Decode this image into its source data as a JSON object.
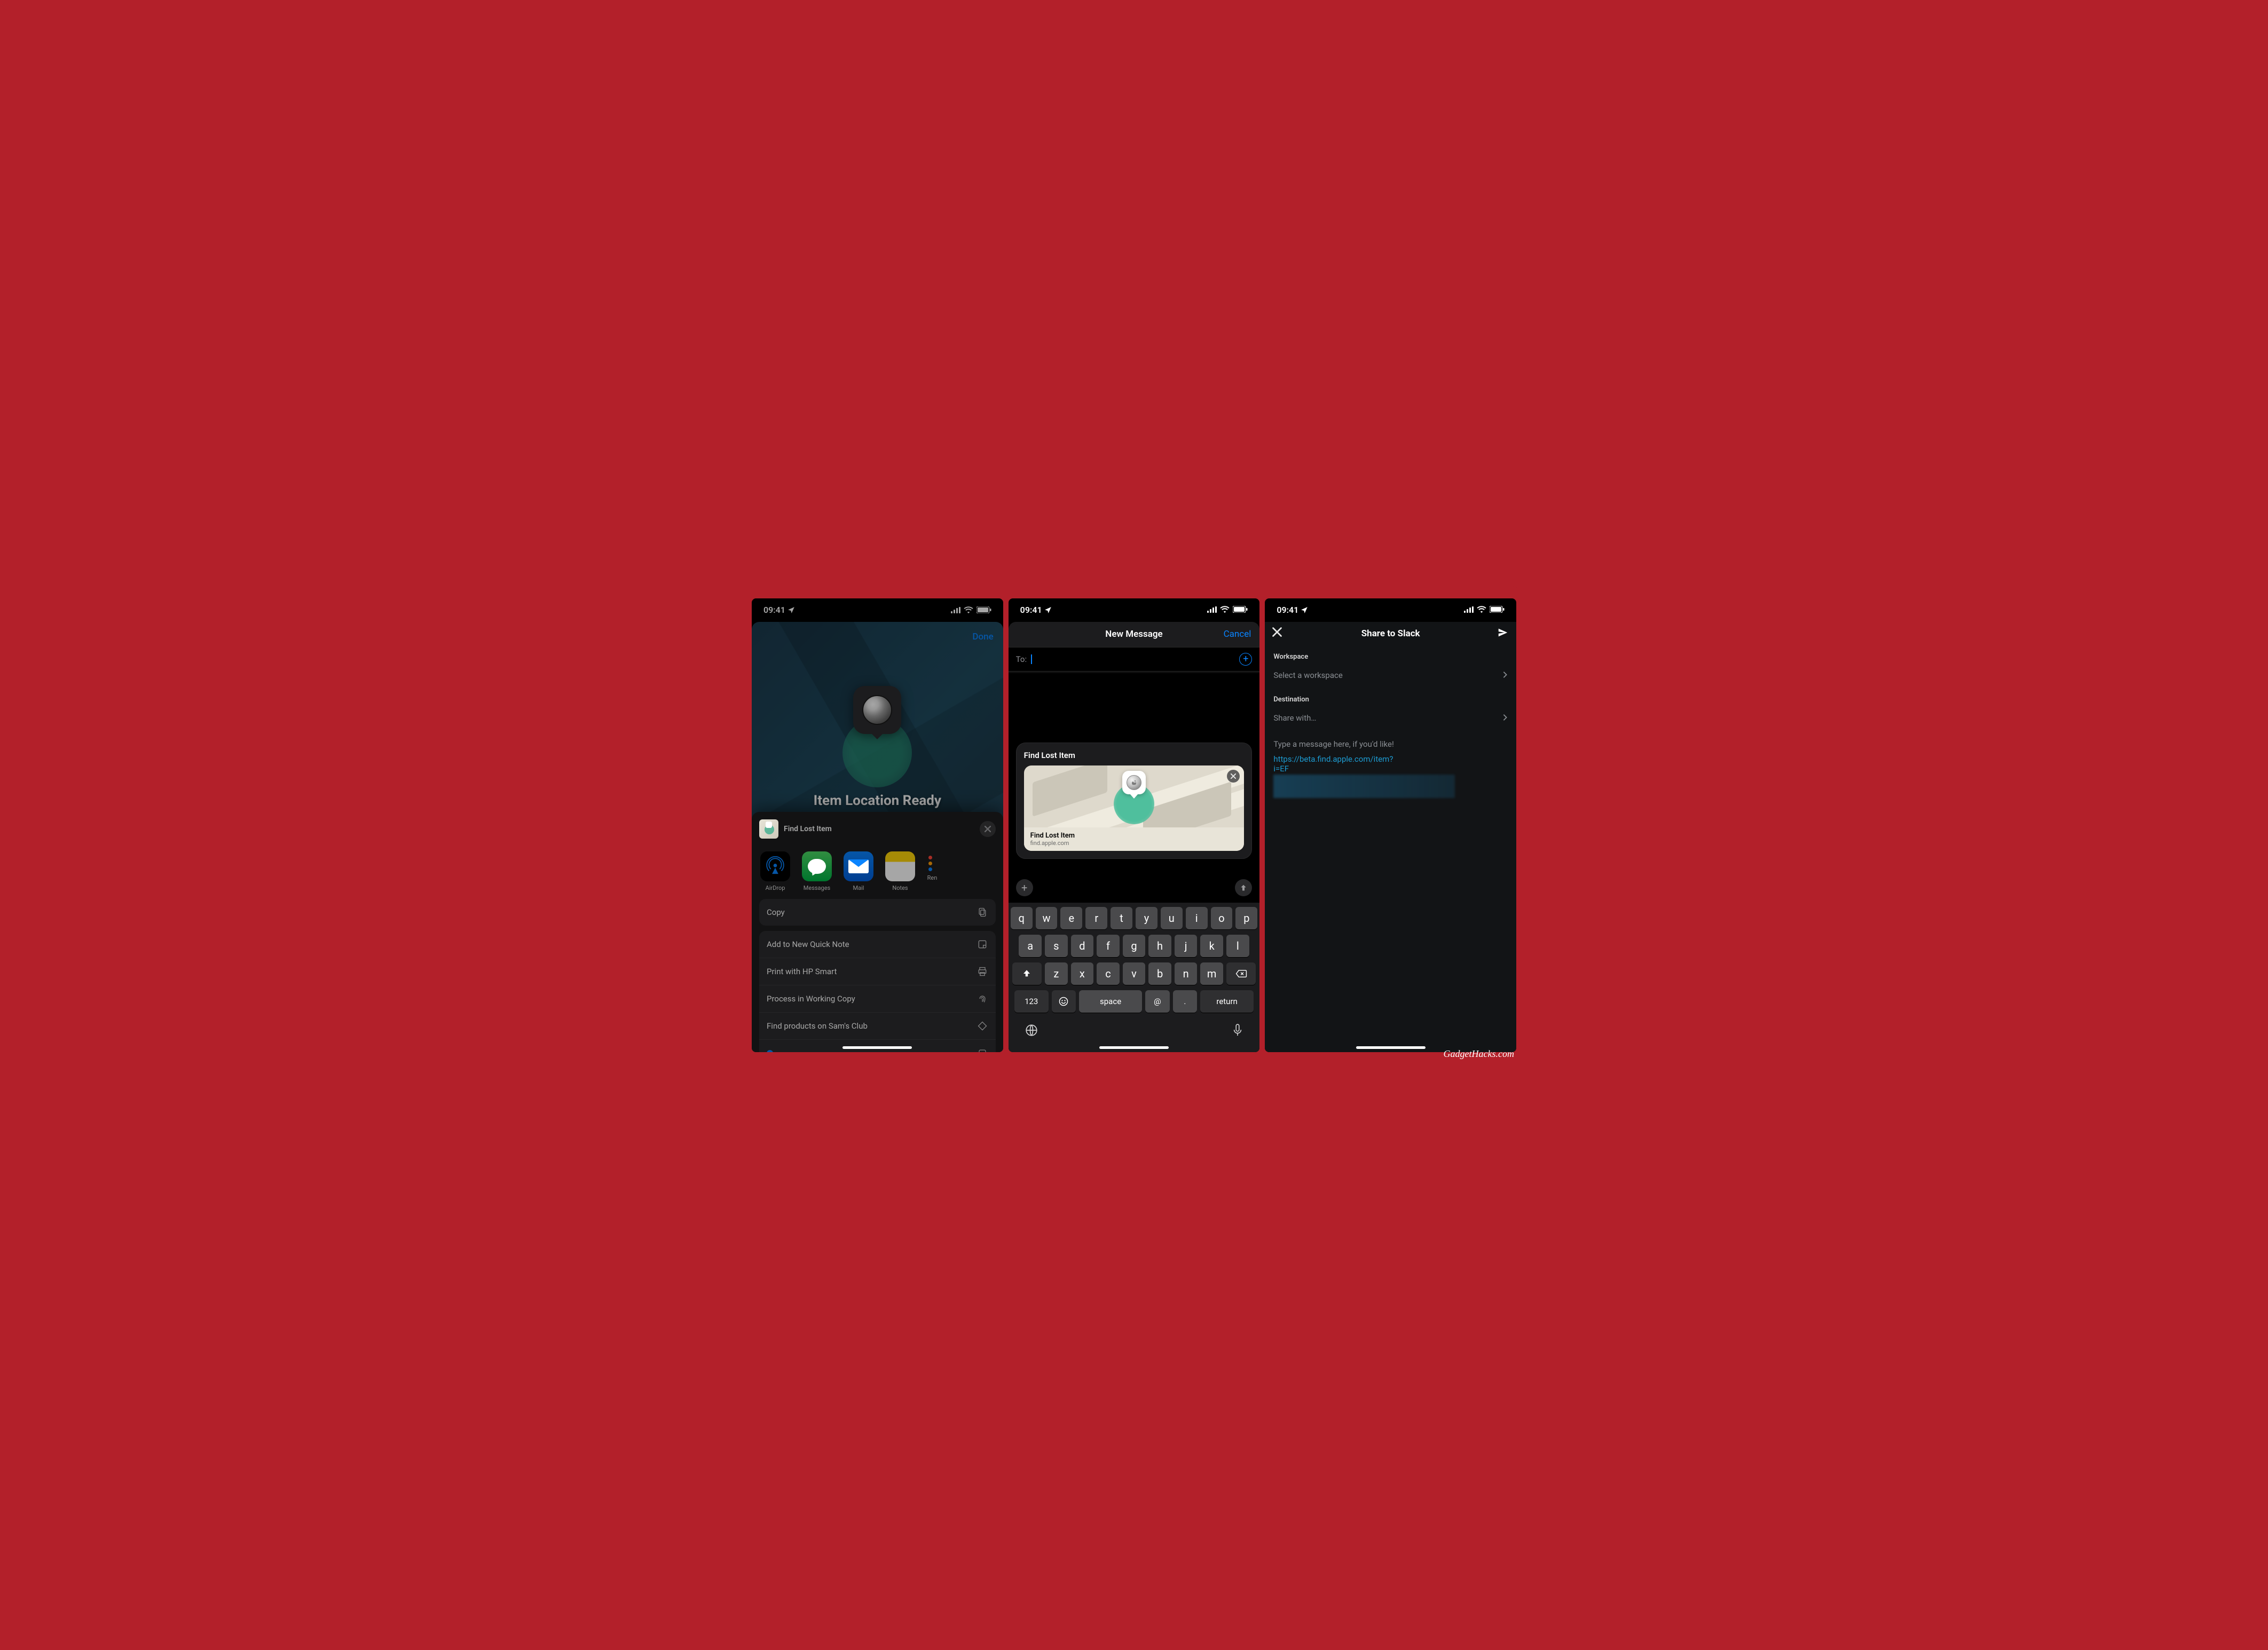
{
  "statusbar": {
    "time": "09:41"
  },
  "watermark": "GadgetHacks.com",
  "phone1": {
    "done": "Done",
    "heading": "Item Location Ready",
    "share": {
      "title": "Find Lost Item",
      "apps": [
        {
          "label": "AirDrop",
          "icon": "airdrop"
        },
        {
          "label": "Messages",
          "icon": "messages"
        },
        {
          "label": "Mail",
          "icon": "mail"
        },
        {
          "label": "Notes",
          "icon": "notes"
        },
        {
          "label": "Ren",
          "icon": "reminders"
        }
      ],
      "copy": "Copy",
      "actions": [
        "Add to New Quick Note",
        "Print with HP Smart",
        "Process in Working Copy",
        "Find products on Sam's Club"
      ]
    }
  },
  "phone2": {
    "nav_title": "New Message",
    "cancel": "Cancel",
    "to_label": "To:",
    "card_title": "Find Lost Item",
    "preview_title": "Find Lost Item",
    "preview_domain": "find.apple.com",
    "keyboard_rows": {
      "r1": [
        "q",
        "w",
        "e",
        "r",
        "t",
        "y",
        "u",
        "i",
        "o",
        "p"
      ],
      "r2": [
        "a",
        "s",
        "d",
        "f",
        "g",
        "h",
        "j",
        "k",
        "l"
      ],
      "r3": [
        "z",
        "x",
        "c",
        "v",
        "b",
        "n",
        "m"
      ],
      "num": "123",
      "space": "space",
      "at": "@",
      "dot": ".",
      "ret": "return"
    }
  },
  "phone3": {
    "title": "Share to Slack",
    "workspace_label": "Workspace",
    "workspace_placeholder": "Select a workspace",
    "destination_label": "Destination",
    "destination_placeholder": "Share with…",
    "message_placeholder": "Type a message here, if you'd like!",
    "link_line1": "https://beta.find.apple.com/item?",
    "link_line2": "i=EF"
  }
}
